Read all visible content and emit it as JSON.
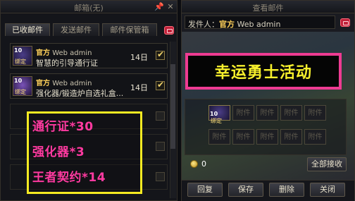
{
  "mailbox": {
    "title": "邮箱(无)",
    "tabs": [
      {
        "label": "已收邮件",
        "active": true
      },
      {
        "label": "发送邮件",
        "active": false
      },
      {
        "label": "邮件保管箱",
        "active": false
      }
    ],
    "mails": [
      {
        "badge": "10",
        "badge_label": "绑定",
        "sender_tag": "官方",
        "sender": "Web admin",
        "subject": "智慧的引导通行证",
        "days": "14日",
        "checked": true
      },
      {
        "badge": "10",
        "badge_label": "绑定",
        "sender_tag": "官方",
        "sender": "Web admin",
        "subject": "强化器/锻造炉自选礼盒...",
        "days": "14日",
        "checked": true
      }
    ],
    "empty_rows": 3
  },
  "overlay_rewards": [
    "通行证*30",
    "强化器*3",
    "王者契约*14"
  ],
  "detail": {
    "title": "查看邮件",
    "sender_label": "发件人：",
    "sender_tag": "官方",
    "sender": "Web admin",
    "banner": "幸运勇士活动",
    "attachment_label": "附件",
    "attachment_item_badge": "10",
    "attachment_item_label": "绑定",
    "gold_value": "0",
    "receive_all": "全部接收",
    "buttons": {
      "reply": "回复",
      "save": "保存",
      "delete": "删除",
      "close": "关闭"
    }
  },
  "colors": {
    "overlay_border": "#f5ea22",
    "overlay_text": "#ff3aa0",
    "banner_border": "#ee3b92",
    "banner_text": "#f7f02c",
    "gold": "#ffd15a"
  },
  "icons": [
    "pin-icon",
    "close-icon",
    "mailbox-red-icon",
    "checkbox-icon",
    "gold-coin-icon"
  ]
}
